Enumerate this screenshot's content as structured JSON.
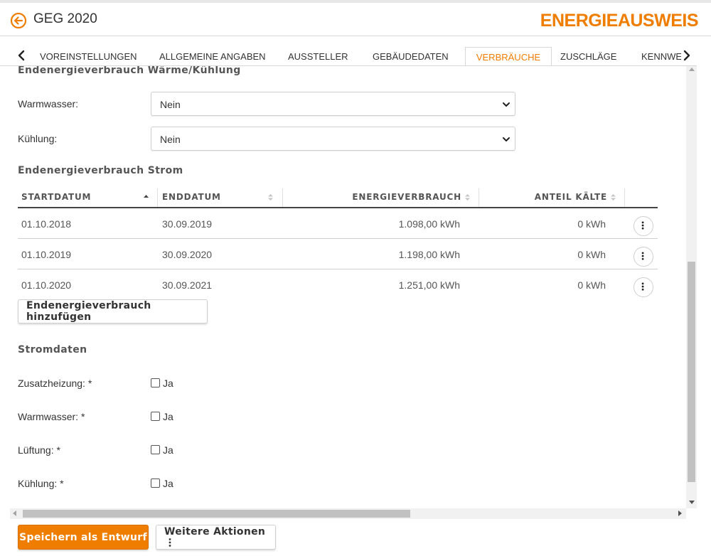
{
  "header": {
    "title": "GEG 2020",
    "brand": "ENERGIEAUSWEIS",
    "accent_color": "#ef7d00",
    "back_icon": "arrow-left-circle-icon"
  },
  "tabs": [
    {
      "label": "VOREINSTELLUNGEN"
    },
    {
      "label": "ALLGEMEINE ANGABEN"
    },
    {
      "label": "AUSSTELLER"
    },
    {
      "label": "GEBÄUDEDATEN"
    },
    {
      "label": "VERBRÄUCHE",
      "active": true
    },
    {
      "label": "ZUSCHLÄGE"
    },
    {
      "label": "KENNWE"
    }
  ],
  "section_waerme": {
    "title": "Endenergieverbrauch Wärme/Kühlung",
    "fields": [
      {
        "label": "Warmwasser:",
        "value": "Nein"
      },
      {
        "label": "Kühlung:",
        "value": "Nein"
      }
    ]
  },
  "section_strom": {
    "title": "Endenergieverbrauch Strom",
    "columns": [
      "STARTDATUM",
      "ENDDATUM",
      "ENERGIEVERBRAUCH",
      "ANTEIL KÄLTE"
    ],
    "rows": [
      [
        "01.10.2018",
        "30.09.2019",
        "1.098,00 kWh",
        "0 kWh"
      ],
      [
        "01.10.2019",
        "30.09.2020",
        "1.198,00 kWh",
        "0 kWh"
      ],
      [
        "01.10.2020",
        "30.09.2021",
        "1.251,00 kWh",
        "0 kWh"
      ]
    ],
    "add_button": "Endenergieverbrauch hinzufügen"
  },
  "section_stromdaten": {
    "title": "Stromdaten",
    "fields": [
      {
        "label": "Zusatzheizung:",
        "required": "*",
        "checkbox_label": "Ja",
        "checked": false
      },
      {
        "label": "Warmwasser:",
        "required": "*",
        "checkbox_label": "Ja",
        "checked": false
      },
      {
        "label": "Lüftung:",
        "required": "*",
        "checkbox_label": "Ja",
        "checked": false
      },
      {
        "label": "Kühlung:",
        "required": "*",
        "checkbox_label": "Ja",
        "checked": false
      }
    ]
  },
  "footer": {
    "save_label": "Speichern als Entwurf",
    "more_label": "Weitere Aktionen",
    "more_icon": "vertical-dots-icon"
  }
}
